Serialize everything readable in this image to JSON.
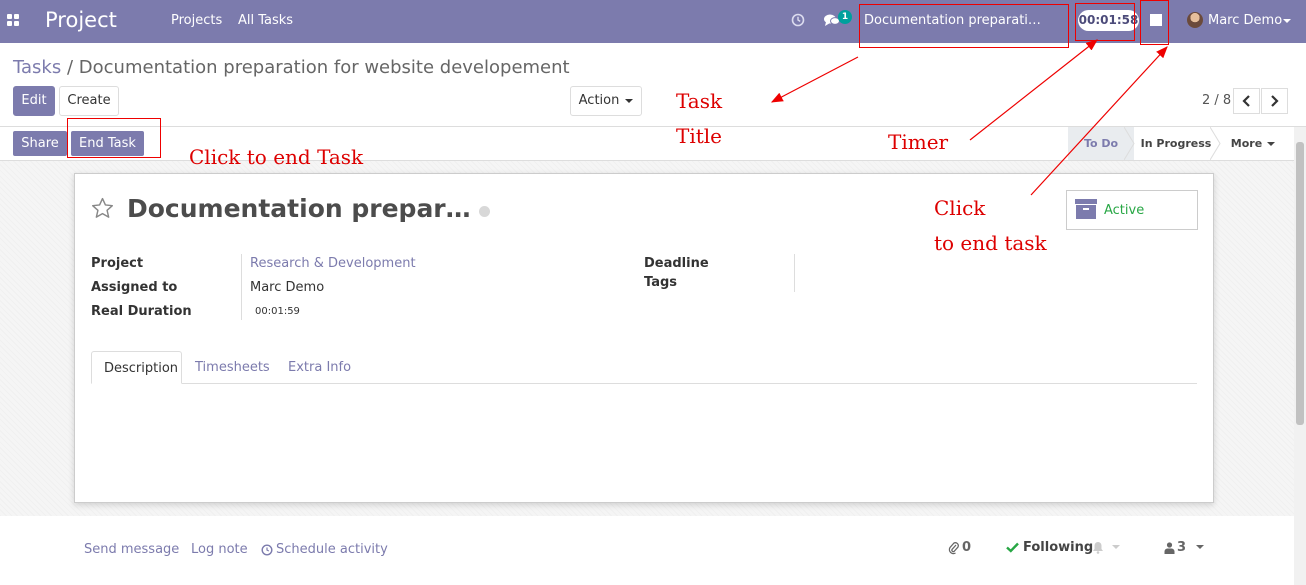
{
  "navbar": {
    "brand": "Project",
    "menu": [
      "Projects",
      "All Tasks"
    ],
    "chat_badge": "1",
    "timer_task_title": "Documentation preparation for we…",
    "timer_value": "00:01:58",
    "user_name": "Marc Demo"
  },
  "breadcrumb": {
    "parent": "Tasks",
    "separator": "/",
    "current": "Documentation preparation for website developement"
  },
  "toolbar": {
    "edit_label": "Edit",
    "create_label": "Create",
    "action_label": "Action",
    "pager": "2 / 8"
  },
  "header_buttons": {
    "share_label": "Share",
    "end_task_label": "End Task"
  },
  "stages": {
    "todo": "To Do",
    "in_progress": "In Progress",
    "more": "More"
  },
  "task": {
    "name": "Documentation preparatio…",
    "active_label": "Active",
    "fields": {
      "project_label": "Project",
      "project_value": "Research & Development",
      "assigned_label": "Assigned to",
      "assigned_value": "Marc Demo",
      "duration_label": "Real Duration",
      "duration_value": "00:01:59",
      "deadline_label": "Deadline",
      "tags_label": "Tags"
    },
    "tabs": [
      "Description",
      "Timesheets",
      "Extra Info"
    ]
  },
  "chatter": {
    "send_message": "Send message",
    "log_note": "Log note",
    "schedule_activity": "Schedule activity",
    "attachments_count": "0",
    "following_label": "Following",
    "followers_count": "3"
  },
  "annotations": {
    "task_title_1": "Task",
    "task_title_2": "Title",
    "timer": "Timer",
    "click_end_task": "Click to end Task",
    "click_1": "Click",
    "click_2": "to end task"
  },
  "colors": {
    "brand": "#7c7bad",
    "annotation": "#dd0000",
    "active_status": "#28a745",
    "badge": "#00a09d"
  }
}
